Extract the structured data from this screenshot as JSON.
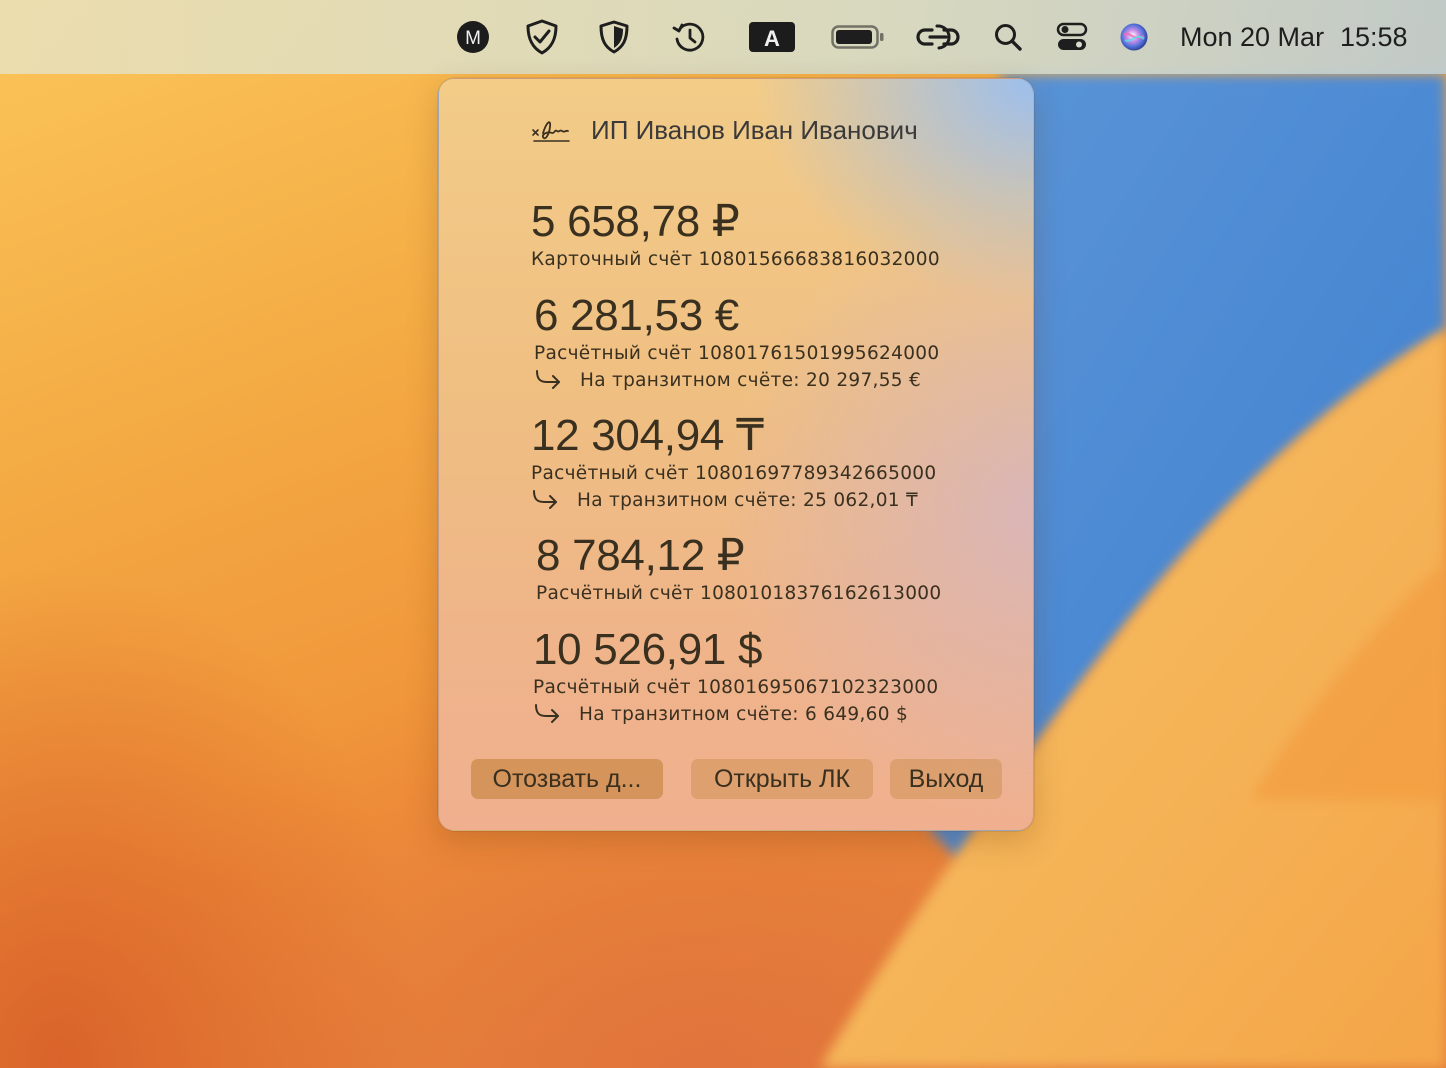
{
  "menubar": {
    "icons": [
      "m-app-icon",
      "shield-check-icon",
      "shield-icon",
      "time-machine-icon",
      "keyboard-input-a-icon",
      "battery-icon",
      "link-icon",
      "search-icon",
      "control-center-icon",
      "siri-icon"
    ],
    "input_letter": "A",
    "m_letter": "M",
    "date": "Mon 20 Mar",
    "time": "15:58"
  },
  "popup": {
    "owner": "ИП Иванов Иван Иванович",
    "accounts": [
      {
        "amount": "5 658,78 ₽",
        "label": "Карточный счёт 10801566683816032000",
        "transit": ""
      },
      {
        "amount": "6 281,53 €",
        "label": "Расчётный счёт 10801761501995624000",
        "transit": "На транзитном счёте: 20 297,55 €"
      },
      {
        "amount": "12 304,94 ₸",
        "label": "Расчётный счёт 10801697789342665000",
        "transit": "На транзитном счёте: 25 062,01 ₸"
      },
      {
        "amount": "8 784,12 ₽",
        "label": "Расчётный счёт 10801018376162613000",
        "transit": ""
      },
      {
        "amount": "10 526,91 $",
        "label": "Расчётный счёт 10801695067102323000",
        "transit": "На транзитном счёте: 6 649,60 $"
      }
    ],
    "buttons": {
      "revoke": "Отозвать д...",
      "open": "Открыть ЛК",
      "exit": "Выход"
    }
  },
  "colors": {
    "menubar_text": "#1e1e1e",
    "popup_text": "#3a3020",
    "wallpaper_orange": "#f4ab44",
    "wallpaper_blue": "#4f8fd6"
  }
}
